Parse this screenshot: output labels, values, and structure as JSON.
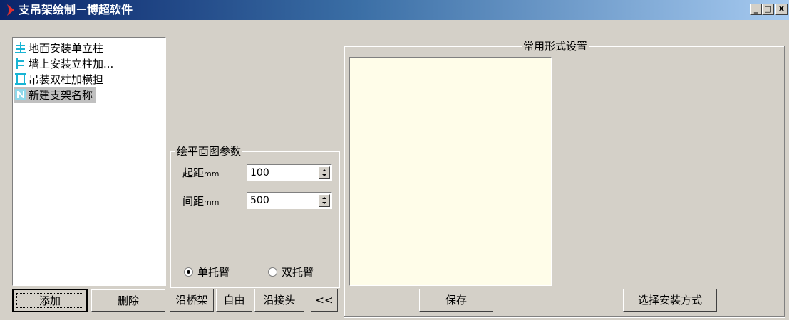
{
  "window": {
    "title": "支吊架绘制－博超软件",
    "controls": {
      "minimize": "_",
      "maximize": "□",
      "close": "X"
    }
  },
  "support_list": {
    "items": [
      {
        "label": "地面安装单立柱",
        "icon": "floor-column-icon",
        "selected": false
      },
      {
        "label": "墙上安装立柱加...",
        "icon": "wall-column-icon",
        "selected": false
      },
      {
        "label": "吊装双柱加横担",
        "icon": "hanger-double-column-icon",
        "selected": false
      },
      {
        "label": "新建支架名称",
        "icon": "new-support-icon",
        "selected": true
      }
    ],
    "add_label": "添加",
    "delete_label": "删除"
  },
  "plan_params": {
    "group_label": "绘平面图参数",
    "start_distance_label": "起距",
    "start_distance_unit": "mm",
    "start_distance_value": "100",
    "spacing_label": "间距",
    "spacing_unit": "mm",
    "spacing_value": "500",
    "arm_options": [
      {
        "label": "单托臂",
        "checked": true
      },
      {
        "label": "双托臂",
        "checked": false
      }
    ]
  },
  "mode_buttons": {
    "along_tray": "沿桥架",
    "free": "自由",
    "along_joint": "沿接头",
    "collapse": "<<"
  },
  "common_form": {
    "group_label": "常用形式设置",
    "save_label": "保存",
    "select_install_label": "选择安装方式"
  },
  "colors": {
    "title_gradient_start": "#0a246a",
    "title_gradient_end": "#a6caf0",
    "face": "#d4d0c8",
    "preview_bg": "#fffde9",
    "icon_cyan": "#18b4d4",
    "selection_bg": "#c0c0c0"
  }
}
